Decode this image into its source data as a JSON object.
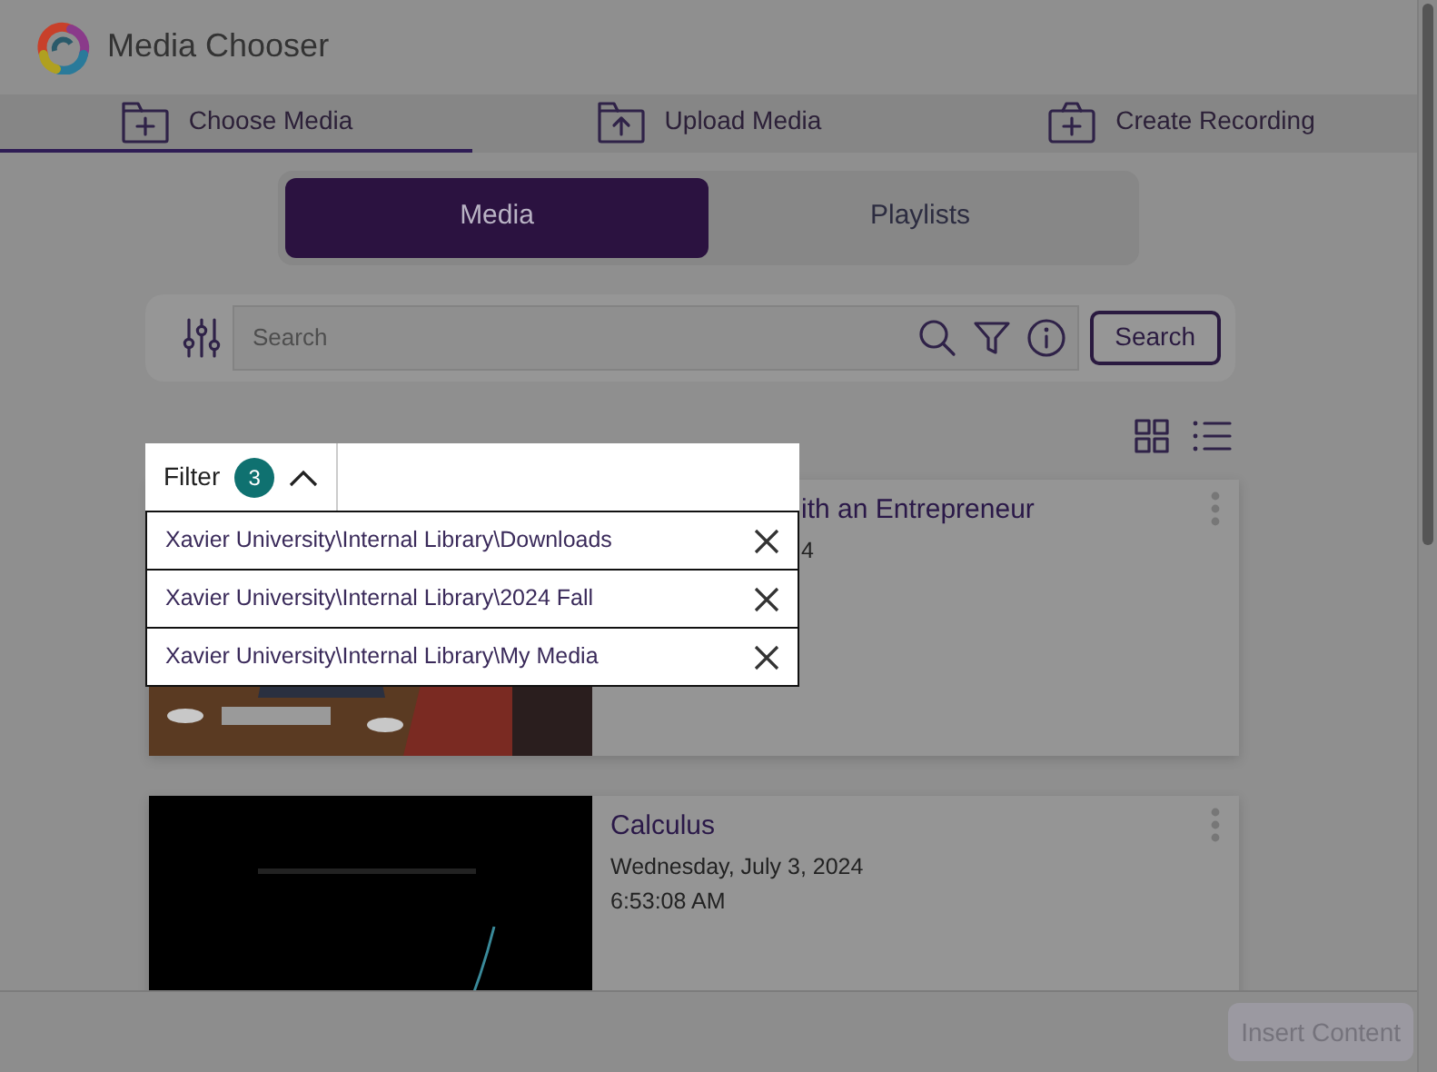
{
  "app": {
    "title": "Media Chooser"
  },
  "tabs": [
    {
      "label": "Choose Media",
      "selected": true
    },
    {
      "label": "Upload Media",
      "selected": false
    },
    {
      "label": "Create Recording",
      "selected": false
    }
  ],
  "segments": [
    {
      "label": "Media",
      "selected": true
    },
    {
      "label": "Playlists",
      "selected": false
    }
  ],
  "search": {
    "placeholder": "Search",
    "button": "Search"
  },
  "filter": {
    "label": "Filter",
    "count": "3",
    "expanded": true,
    "items": [
      {
        "label": "Xavier University\\Internal Library\\Downloads"
      },
      {
        "label": "Xavier University\\Internal Library\\2024 Fall"
      },
      {
        "label": "Xavier University\\Internal Library\\My Media"
      }
    ]
  },
  "media": [
    {
      "title": "ith an Entrepreneur",
      "date": "4"
    },
    {
      "title": "Calculus",
      "date": "Wednesday, July 3, 2024",
      "time": "6:53:08 AM"
    }
  ],
  "footer": {
    "button": "Insert Content",
    "disabled": true
  }
}
